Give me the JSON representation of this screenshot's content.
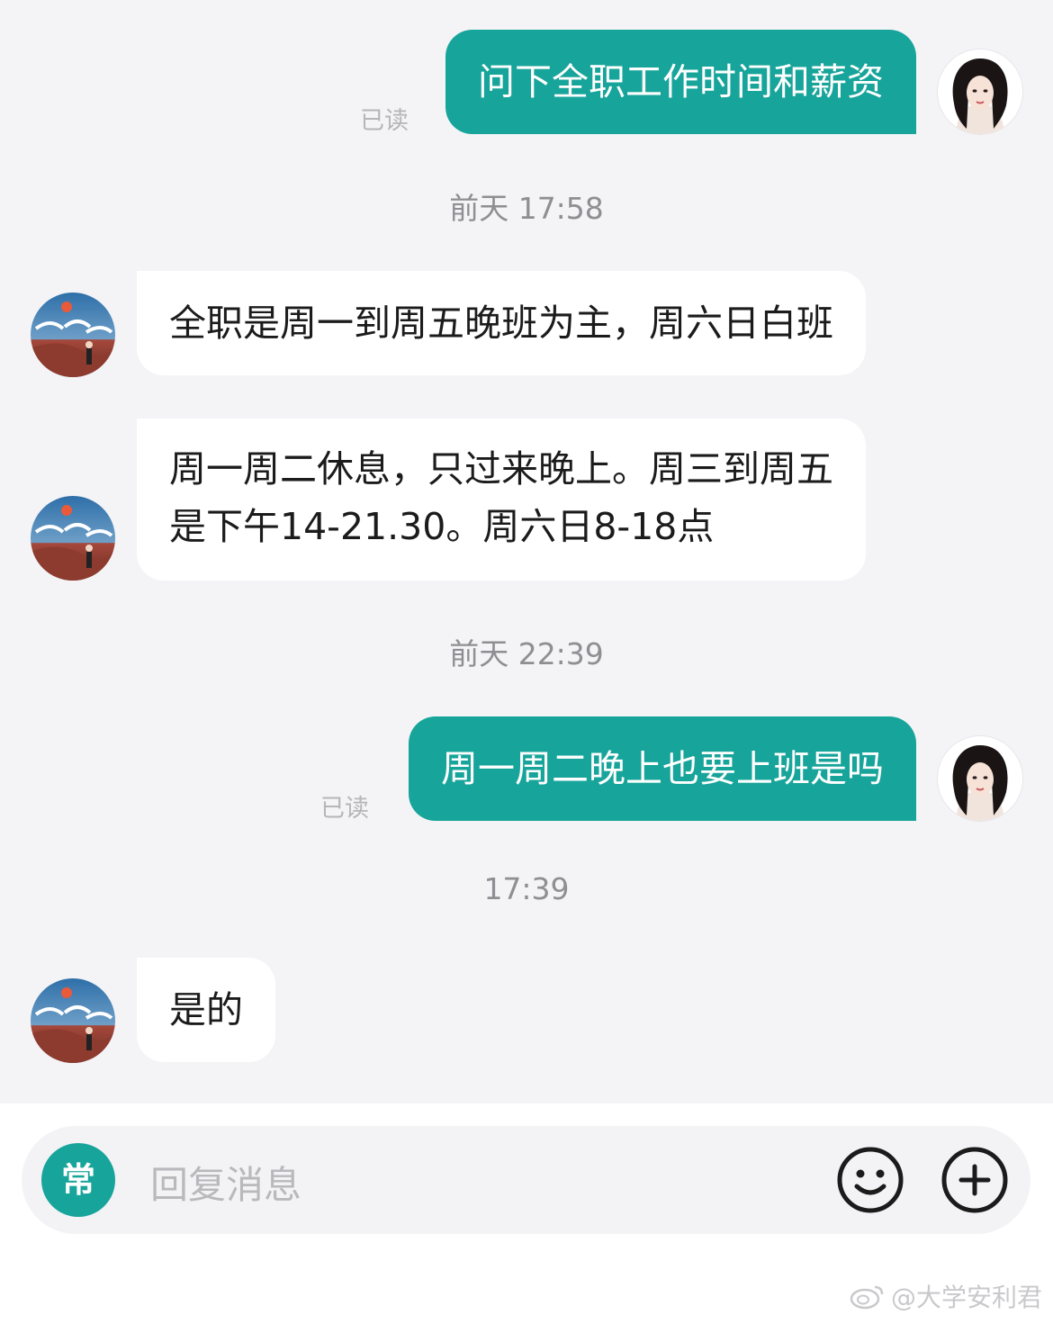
{
  "messages": [
    {
      "id": "m1",
      "from": "self",
      "text": "问下全职工作时间和薪资",
      "status": "已读"
    },
    {
      "id": "t1",
      "type": "timestamp",
      "text": "前天 17:58"
    },
    {
      "id": "m2",
      "from": "other",
      "text": "全职是周一到周五晚班为主，周六日白班"
    },
    {
      "id": "m3",
      "from": "other",
      "lines": [
        "周一周二休息，只过来晚上。周三到周五",
        "是下午14-21.30。周六日8-18点"
      ]
    },
    {
      "id": "t2",
      "type": "timestamp",
      "text": "前天 22:39"
    },
    {
      "id": "m4",
      "from": "self",
      "text": "周一周二晚上也要上班是吗",
      "status": "已读"
    },
    {
      "id": "t3",
      "type": "timestamp",
      "text": "17:39"
    },
    {
      "id": "m5",
      "from": "other",
      "text": "是的"
    }
  ],
  "input": {
    "quick_label": "常",
    "placeholder": "回复消息"
  },
  "icons": {
    "emoji": "emoji-smile-icon",
    "plus": "plus-circle-icon",
    "quick": "quick-reply-icon"
  },
  "watermark": {
    "text": "@大学安利君"
  },
  "colors": {
    "accent": "#17a49a",
    "background": "#f4f4f7"
  }
}
